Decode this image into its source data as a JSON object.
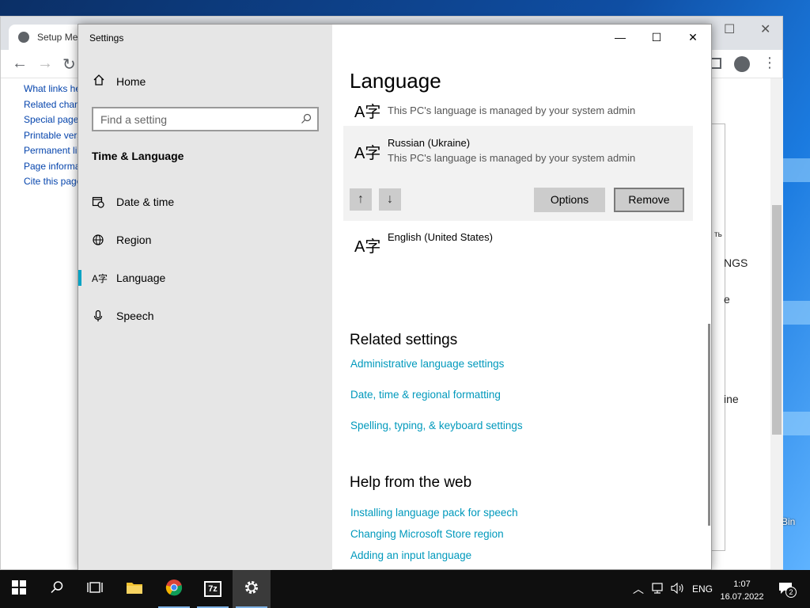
{
  "browser": {
    "tab_title": "Setup Me",
    "wiki_links": [
      "What links here",
      "Related changes",
      "Special pages",
      "Printable version",
      "Permanent link",
      "Page information",
      "Cite this page"
    ],
    "right_fragments": [
      "ть",
      "NGS",
      "e",
      "ine"
    ]
  },
  "settings": {
    "window_title": "Settings",
    "home_label": "Home",
    "search_placeholder": "Find a setting",
    "section_title": "Time & Language",
    "nav_items": [
      {
        "label": "Date & time"
      },
      {
        "label": "Region"
      },
      {
        "label": "Language"
      },
      {
        "label": "Speech"
      }
    ],
    "page_title": "Language",
    "languages": [
      {
        "name": "",
        "desc": "This PC's language is managed by your system admin"
      },
      {
        "name": "Russian (Ukraine)",
        "desc": "This PC's language is managed by your system admin"
      },
      {
        "name": "English (United States)",
        "desc": ""
      }
    ],
    "lang_glyph": "A字",
    "move_up": "↑",
    "move_down": "↓",
    "options_label": "Options",
    "remove_label": "Remove",
    "related_title": "Related settings",
    "related_links": [
      "Administrative language settings",
      "Date, time & regional formatting",
      "Spelling, typing, & keyboard settings"
    ],
    "help_title": "Help from the web",
    "help_links": [
      "Installing language pack for speech",
      "Changing Microsoft Store region",
      "Adding an input language"
    ]
  },
  "desktop": {
    "recycle_label": "Bin"
  },
  "taskbar": {
    "lang": "ENG",
    "time": "1:07",
    "date": "16.07.2022",
    "notification_count": "2",
    "accent": "#00a3c4"
  }
}
